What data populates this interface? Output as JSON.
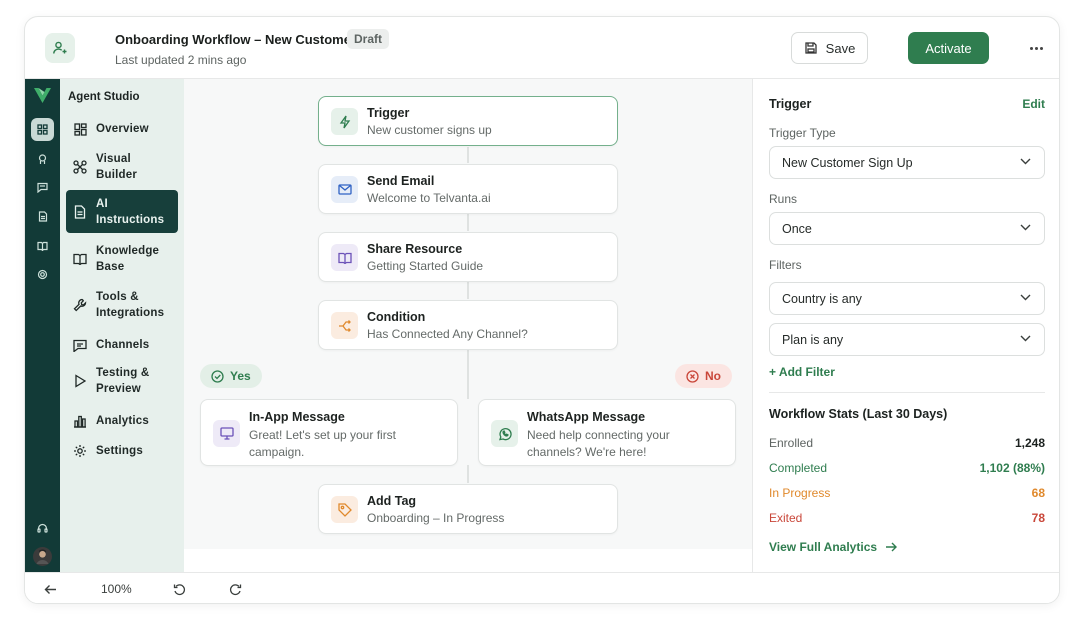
{
  "header": {
    "title": "Onboarding Workflow – New Customer",
    "badge": "Draft",
    "subtitle": "Last updated 2 mins ago",
    "save_label": "Save",
    "activate_label": "Activate"
  },
  "rail": {
    "icons": [
      "dashboard-icon",
      "bot-icon",
      "chat-icon",
      "document-icon",
      "book-icon",
      "settings-icon",
      "headset-icon",
      "user-avatar"
    ]
  },
  "sidebar": {
    "title": "Agent Studio",
    "items": [
      {
        "label": "Overview",
        "icon": "grid-icon"
      },
      {
        "label": "Visual Builder",
        "icon": "workflow-icon"
      },
      {
        "label": "AI Instructions",
        "icon": "document-icon"
      },
      {
        "label": "Knowledge Base",
        "icon": "book-icon"
      },
      {
        "label": "Tools & Integrations",
        "icon": "wrench-icon"
      },
      {
        "label": "Channels",
        "icon": "chat-icon"
      },
      {
        "label": "Testing & Preview",
        "icon": "play-icon"
      },
      {
        "label": "Analytics",
        "icon": "bar-chart-icon"
      },
      {
        "label": "Settings",
        "icon": "gear-icon"
      }
    ],
    "active_index": 2
  },
  "canvas": {
    "nodes": [
      {
        "title": "Trigger",
        "subtitle": "New customer signs up",
        "icon": "lightning-icon"
      },
      {
        "title": "Send Email",
        "subtitle": "Welcome to Telvanta.ai",
        "icon": "mail-icon"
      },
      {
        "title": "Share Resource",
        "subtitle": "Getting Started Guide",
        "icon": "book-open-icon"
      },
      {
        "title": "Condition",
        "subtitle": "Has Connected Any Channel?",
        "icon": "split-icon"
      }
    ],
    "branch_yes": {
      "label": "Yes",
      "node": {
        "title": "In-App Message",
        "subtitle": "Great! Let's set up your first campaign.",
        "icon": "monitor-icon"
      }
    },
    "branch_no": {
      "label": "No",
      "node": {
        "title": "WhatsApp Message",
        "subtitle": "Need help connecting your channels? We're here!",
        "icon": "whatsapp-icon"
      }
    },
    "final_node": {
      "title": "Add Tag",
      "subtitle": "Onboarding – In Progress",
      "icon": "tag-icon"
    }
  },
  "panel": {
    "title": "Trigger",
    "edit_label": "Edit",
    "trigger_type_label": "Trigger Type",
    "trigger_type_value": "New Customer Sign Up",
    "runs_label": "Runs",
    "runs_value": "Once",
    "filters_label": "Filters",
    "filters": [
      "Country is any",
      "Plan is any"
    ],
    "add_filter_label": "+ Add Filter",
    "stats_title": "Workflow Stats (Last 30 Days)",
    "stats": [
      {
        "label": "Enrolled",
        "value": "1,248",
        "color": "#1c2220",
        "label_color": "#5e6462"
      },
      {
        "label": "Completed",
        "value": "1,102 (88%)",
        "color": "#2f7d4f",
        "label_color": "#2f7d4f"
      },
      {
        "label": "In Progress",
        "value": "68",
        "color": "#e0892c",
        "label_color": "#e0892c"
      },
      {
        "label": "Exited",
        "value": "78",
        "color": "#c9473a",
        "label_color": "#c9473a"
      }
    ],
    "analytics_link": "View Full Analytics"
  },
  "bottombar": {
    "zoom": "100%"
  },
  "colors": {
    "brand": "#2f7d4f",
    "rail_bg": "#123a37",
    "sidebar_bg": "#e7f0ec"
  }
}
